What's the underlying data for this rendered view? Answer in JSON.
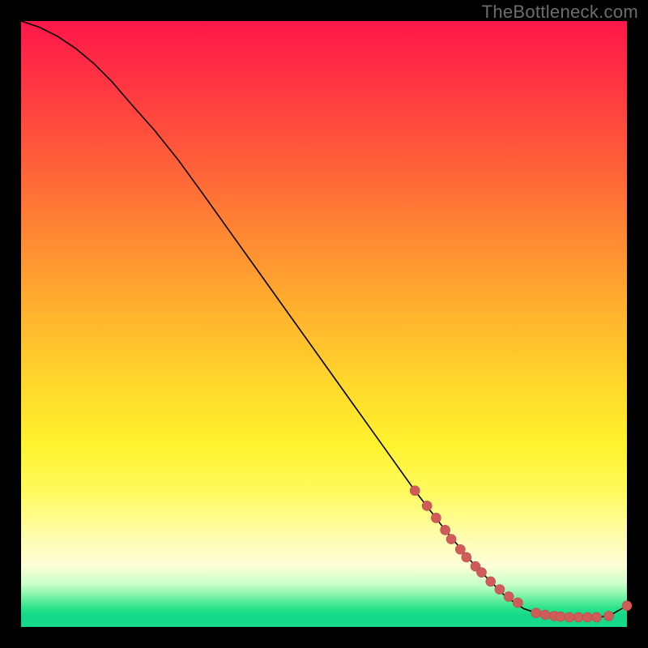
{
  "watermark": "TheBottleneck.com",
  "colors": {
    "frame_bg": "#000000",
    "watermark_text": "#6d6d6d",
    "curve": "#000000",
    "dot_fill": "#cf5c59",
    "dot_stroke": "#bb4a49",
    "gradient_stops": [
      {
        "pct": 0,
        "color": "#ff1749"
      },
      {
        "pct": 8,
        "color": "#ff2e44"
      },
      {
        "pct": 22,
        "color": "#ff5a3a"
      },
      {
        "pct": 35,
        "color": "#ff8733"
      },
      {
        "pct": 48,
        "color": "#ffb22e"
      },
      {
        "pct": 60,
        "color": "#ffd82b"
      },
      {
        "pct": 70,
        "color": "#fff22e"
      },
      {
        "pct": 78,
        "color": "#fffb60"
      },
      {
        "pct": 85,
        "color": "#fffcae"
      },
      {
        "pct": 90,
        "color": "#fcffd8"
      },
      {
        "pct": 93,
        "color": "#c7ffc8"
      },
      {
        "pct": 95,
        "color": "#7af2a6"
      },
      {
        "pct": 97,
        "color": "#27e28a"
      },
      {
        "pct": 98.2,
        "color": "#14d889"
      },
      {
        "pct": 100,
        "color": "#16db8b"
      }
    ]
  },
  "chart_data": {
    "type": "line",
    "title": "",
    "xlabel": "",
    "ylabel": "",
    "xlim": [
      0,
      100
    ],
    "ylim": [
      0,
      100
    ],
    "grid": false,
    "legend": false,
    "notes": "Axes are unlabeled in the source image. x and y are normalized to 0–100 from the visible plot square. The curve descends from top-left, shallow at first then roughly linearly, flattening near y≈2 for x≈85–97 before a small uptick at x=100.",
    "series": [
      {
        "name": "curve",
        "type": "line",
        "x": [
          0,
          3,
          6,
          9,
          12,
          15,
          18,
          22,
          26,
          30,
          35,
          40,
          45,
          50,
          55,
          60,
          65,
          70,
          75,
          80,
          83,
          86,
          89,
          92,
          95,
          97,
          100
        ],
        "y": [
          100,
          99,
          97.5,
          95.5,
          93,
          90,
          86.5,
          82,
          77,
          71.5,
          64.5,
          57.5,
          50.5,
          43.5,
          36.5,
          29.5,
          22.5,
          16,
          10,
          5,
          3,
          2,
          1.7,
          1.6,
          1.6,
          1.8,
          3.5
        ]
      },
      {
        "name": "highlighted-points",
        "type": "scatter",
        "x": [
          65,
          67,
          68.5,
          70,
          71,
          72.5,
          73.5,
          75,
          76,
          77.5,
          79,
          80.5,
          82,
          85,
          86.5,
          88,
          89,
          90.5,
          92,
          93.5,
          95,
          97,
          100
        ],
        "y": [
          22.5,
          20,
          18,
          16,
          14.5,
          12.8,
          11.5,
          10,
          9,
          7.5,
          6.2,
          5,
          4,
          2.3,
          2,
          1.8,
          1.7,
          1.6,
          1.6,
          1.6,
          1.6,
          1.8,
          3.5
        ]
      }
    ]
  }
}
